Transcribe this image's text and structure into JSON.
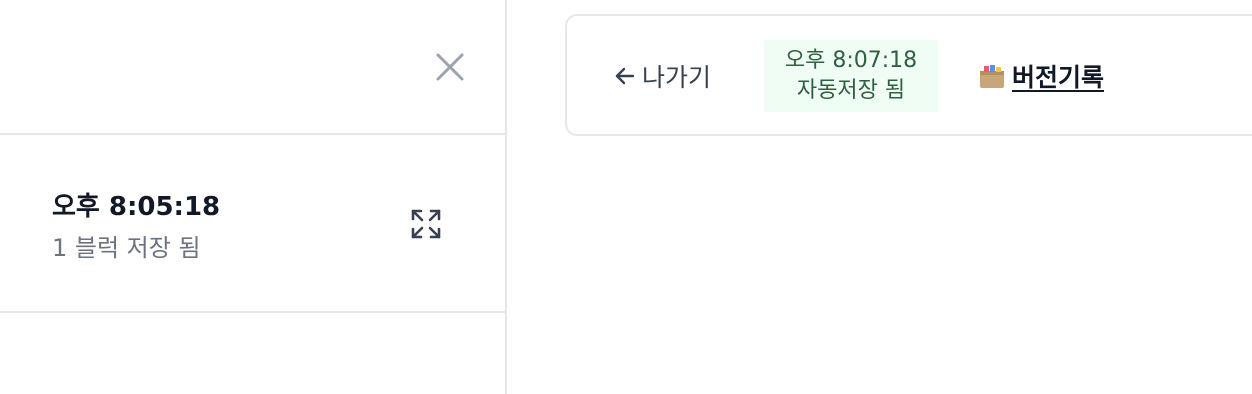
{
  "history_panel": {
    "close_icon": "close-icon",
    "item": {
      "time": "오후 8:05:18",
      "description": "1 블럭 저장 됨",
      "expand_icon": "expand-icon"
    }
  },
  "toolbar": {
    "back_label": "나가기",
    "back_icon": "arrow-left-icon",
    "autosave": {
      "time": "오후 8:07:18",
      "status": "자동저장 됨"
    },
    "version_history_label": "버전기록",
    "version_history_icon": "box-icon"
  },
  "colors": {
    "border": "#e5e7eb",
    "muted_text": "#6b7280",
    "close_icon": "#9ca3af",
    "badge_bg": "#f0fdf4",
    "badge_text": "#2f5f3f"
  }
}
